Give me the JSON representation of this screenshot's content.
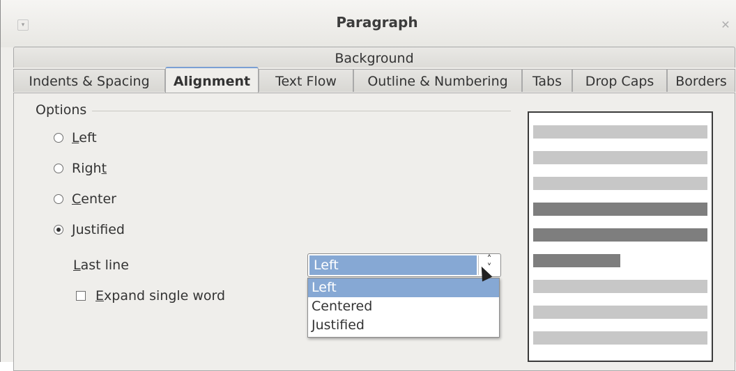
{
  "window": {
    "title": "Paragraph"
  },
  "tabs": {
    "top_row": [
      "Background"
    ],
    "bottom_row": [
      "Indents & Spacing",
      "Alignment",
      "Text Flow",
      "Outline & Numbering",
      "Tabs",
      "Drop Caps",
      "Borders"
    ],
    "active": "Alignment"
  },
  "options": {
    "section_label": "Options",
    "radios": [
      {
        "pre": "",
        "key": "L",
        "post": "eft",
        "selected": false
      },
      {
        "pre": "Righ",
        "key": "t",
        "post": "",
        "selected": false
      },
      {
        "pre": "",
        "key": "C",
        "post": "enter",
        "selected": false
      },
      {
        "pre": "",
        "key": "J",
        "post": "ustified",
        "selected": true
      }
    ],
    "last_line": {
      "label_key": "L",
      "label_rest": "ast line",
      "value": "Left",
      "options": [
        "Left",
        "Centered",
        "Justified"
      ],
      "selected_option": "Left"
    },
    "expand_single_word": {
      "label_key": "E",
      "label_rest": "xpand single word",
      "checked": false
    }
  },
  "preview": {
    "lines": [
      {
        "shade": "light",
        "fill": 1.0
      },
      {
        "shade": "light",
        "fill": 1.0
      },
      {
        "shade": "light",
        "fill": 1.0
      },
      {
        "shade": "dark",
        "fill": 1.0
      },
      {
        "shade": "dark",
        "fill": 1.0
      },
      {
        "shade": "dark",
        "fill": 0.5
      },
      {
        "shade": "light",
        "fill": 1.0
      },
      {
        "shade": "light",
        "fill": 1.0
      },
      {
        "shade": "light",
        "fill": 1.0
      }
    ]
  },
  "icons": {
    "menu": "window-menu-icon",
    "close": "close-icon",
    "combo": "up-down-chevron-icon",
    "cursor": "mouse-pointer-icon"
  }
}
